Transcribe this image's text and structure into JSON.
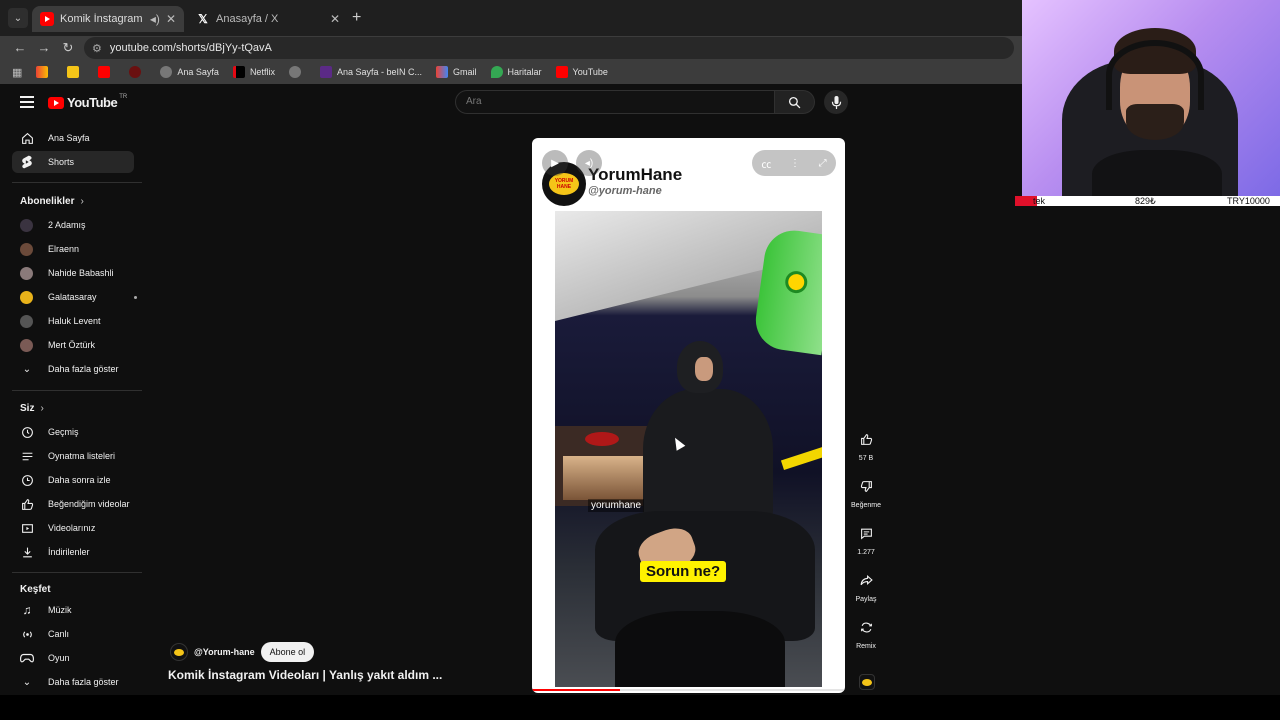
{
  "browser": {
    "tabs": [
      {
        "title": "Komik İnstagram Videoları |",
        "active": true
      },
      {
        "title": "Anasayfa / X",
        "active": false
      }
    ],
    "url": "youtube.com/shorts/dBjYy-tQavA",
    "bookmarks": [
      "Ana Sayfa",
      "Netflix",
      "Ana Sayfa - beIN C...",
      "Gmail",
      "Haritalar",
      "YouTube"
    ]
  },
  "header": {
    "logo_text": "YouTube",
    "country_code": "TR",
    "search_placeholder": "Ara"
  },
  "sidebar": {
    "main": [
      {
        "label": "Ana Sayfa",
        "icon": "home-icon"
      },
      {
        "label": "Shorts",
        "icon": "shorts-icon",
        "active": true
      }
    ],
    "subscriptions_heading": "Abonelikler",
    "subscriptions": [
      {
        "label": "2 Adamış",
        "color": "#3a3340"
      },
      {
        "label": "Elraenn",
        "color": "#6b4a3a"
      },
      {
        "label": "Nahide Babashli",
        "color": "#8a7a7a"
      },
      {
        "label": "Galatasaray",
        "color": "#e8b21a",
        "live": true
      },
      {
        "label": "Haluk Levent",
        "color": "#555555"
      },
      {
        "label": "Mert Öztürk",
        "color": "#7a5a55"
      }
    ],
    "show_more_subs": "Daha fazla göster",
    "you_heading": "Siz",
    "you": [
      {
        "label": "Geçmiş",
        "icon": "history-icon"
      },
      {
        "label": "Oynatma listeleri",
        "icon": "playlist-icon"
      },
      {
        "label": "Daha sonra izle",
        "icon": "watch-later-icon"
      },
      {
        "label": "Beğendiğim videolar",
        "icon": "like-icon"
      },
      {
        "label": "Videolarınız",
        "icon": "your-videos-icon"
      },
      {
        "label": "İndirilenler",
        "icon": "download-icon"
      }
    ],
    "explore_heading": "Keşfet",
    "explore": [
      {
        "label": "Müzik",
        "icon": "music-icon"
      },
      {
        "label": "Canlı",
        "icon": "live-icon"
      },
      {
        "label": "Oyun",
        "icon": "gaming-icon"
      },
      {
        "label": "Daha fazla göster",
        "icon": "chevron-down-icon"
      }
    ]
  },
  "short": {
    "channel_title": "YorumHane",
    "channel_handle": "@yorum-hane",
    "logo_text": "YORUM HANE",
    "watermark": "yorumhane",
    "caption": "Sorun ne?",
    "progress": 0.28
  },
  "actions": {
    "likes": "57 B",
    "dislike_label": "Beğenme",
    "comments": "1.277",
    "share_label": "Paylaş",
    "remix_label": "Remix"
  },
  "meta": {
    "handle": "@Yorum-hane",
    "subscribe_label": "Abone ol",
    "title": "Komik İnstagram Videoları | Yanlış yakıt aldım ..."
  },
  "ticker": {
    "left": "tek",
    "middle": "829₺",
    "right": "TRY10000"
  }
}
